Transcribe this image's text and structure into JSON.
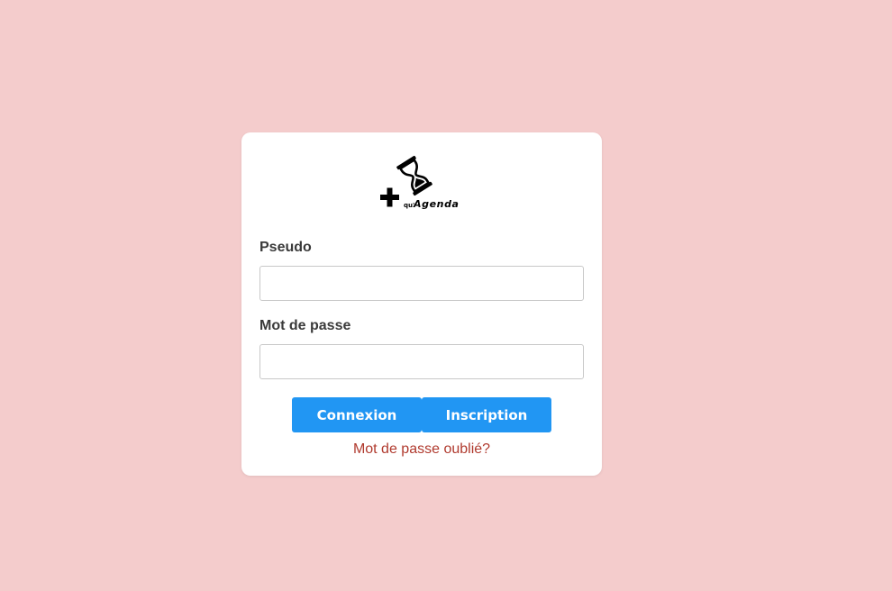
{
  "logo": {
    "prefix_text": "qu'",
    "name_text": "Agenda"
  },
  "form": {
    "pseudo_label": "Pseudo",
    "pseudo_value": "",
    "password_label": "Mot de passe",
    "password_value": "",
    "connexion_label": "Connexion",
    "inscription_label": "Inscription",
    "forgot_label": "Mot de passe oublié?"
  },
  "colors": {
    "background": "#f4cccc",
    "button": "#2196f3",
    "forgot_link": "#b03a2e"
  }
}
